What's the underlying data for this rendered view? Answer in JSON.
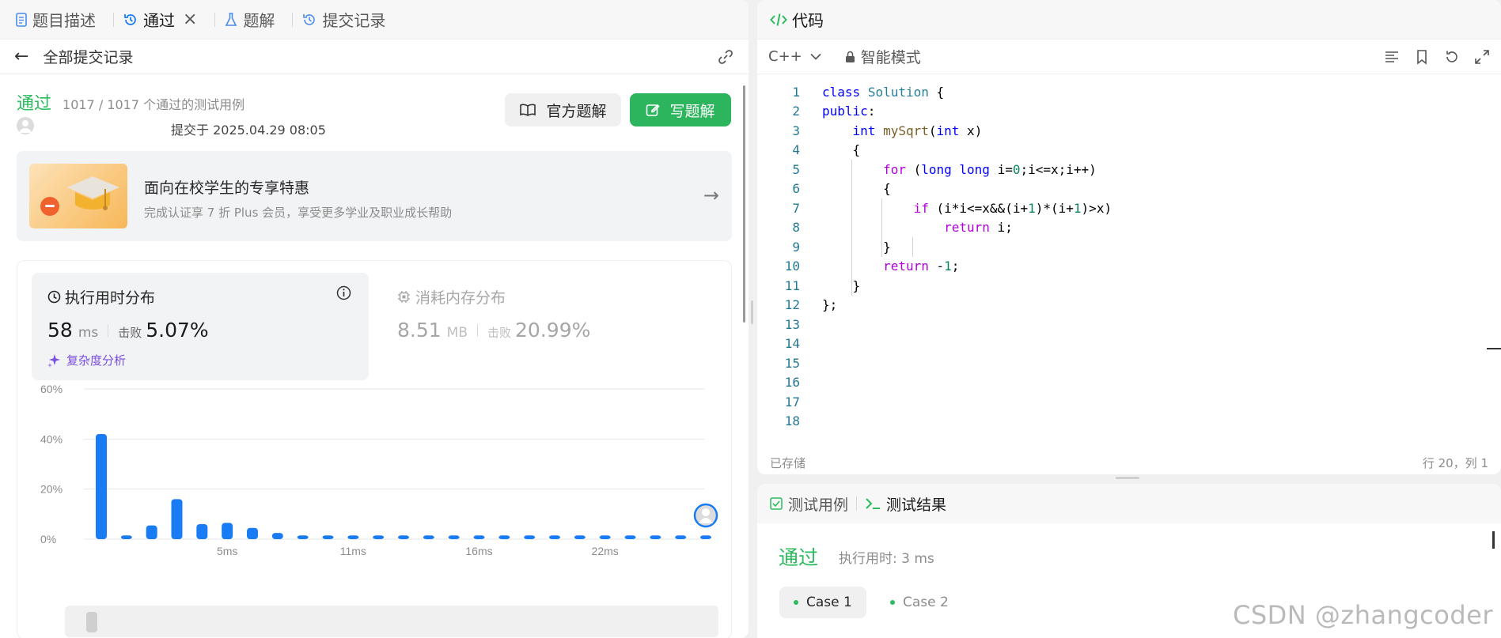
{
  "tabs": [
    {
      "label": "题目描述",
      "icon": "document-icon"
    },
    {
      "label": "通过",
      "icon": "history-icon"
    },
    {
      "label": "题解",
      "icon": "flask-icon"
    },
    {
      "label": "提交记录",
      "icon": "history-icon"
    }
  ],
  "subbar": {
    "title": "全部提交记录"
  },
  "submission": {
    "status": "通过",
    "cases": "1017 / 1017 个通过的测试用例",
    "submitted_at": "提交于 2025.04.29 08:05"
  },
  "buttons": {
    "official": "官方题解",
    "write": "写题解"
  },
  "promo": {
    "title": "面向在校学生的专享特惠",
    "desc": "完成认证享 7 折 Plus 会员，享受更多学业及职业成长帮助"
  },
  "runtime": {
    "title": "执行用时分布",
    "value": "58",
    "unit": "ms",
    "beat_label": "击败",
    "beat": "5.07%",
    "analysis": "复杂度分析"
  },
  "memory": {
    "title": "消耗内存分布",
    "value": "8.51",
    "unit": "MB",
    "beat_label": "击败",
    "beat": "20.99%"
  },
  "chart_data": {
    "type": "bar",
    "ylim": [
      0,
      60
    ],
    "yticks": [
      "60%",
      "40%",
      "20%",
      "0%"
    ],
    "xticks": [
      "5ms",
      "11ms",
      "16ms",
      "22ms"
    ],
    "values": [
      42,
      1.5,
      5.5,
      16,
      6,
      6.5,
      4.5,
      2.5,
      1.5,
      1.5,
      1.5,
      1.5,
      1.5,
      1.5,
      1.5,
      1.5,
      1.5,
      1.5,
      1.5,
      1.5,
      1.5,
      1.5,
      1.5,
      1.5,
      1.5
    ],
    "grid": true,
    "bar_color": "#1a7cf5"
  },
  "code": {
    "title": "代码",
    "language": "C++",
    "mode": "智能模式",
    "saved": "已存储",
    "cursor": "行 20，列 1",
    "lines": [
      "class Solution {",
      "public:",
      "    int mySqrt(int x)",
      "    {",
      "        for (long long i=0;i<=x;i++)",
      "        {",
      "            if (i*i<=x&&(i+1)*(i+1)>x)",
      "                return i;",
      "        }",
      "        return -1;",
      "    }",
      "};",
      "",
      "",
      "",
      "",
      "",
      ""
    ]
  },
  "test": {
    "tab_cases": "测试用例",
    "tab_result": "测试结果",
    "status": "通过",
    "time": "执行用时: 3 ms",
    "case1": "Case 1",
    "case2": "Case 2"
  },
  "watermark": "CSDN @zhangcoder",
  "colors": {
    "pass": "#2cbb5d",
    "write_btn": "#2db55d",
    "accent": "#1a7cf5"
  }
}
